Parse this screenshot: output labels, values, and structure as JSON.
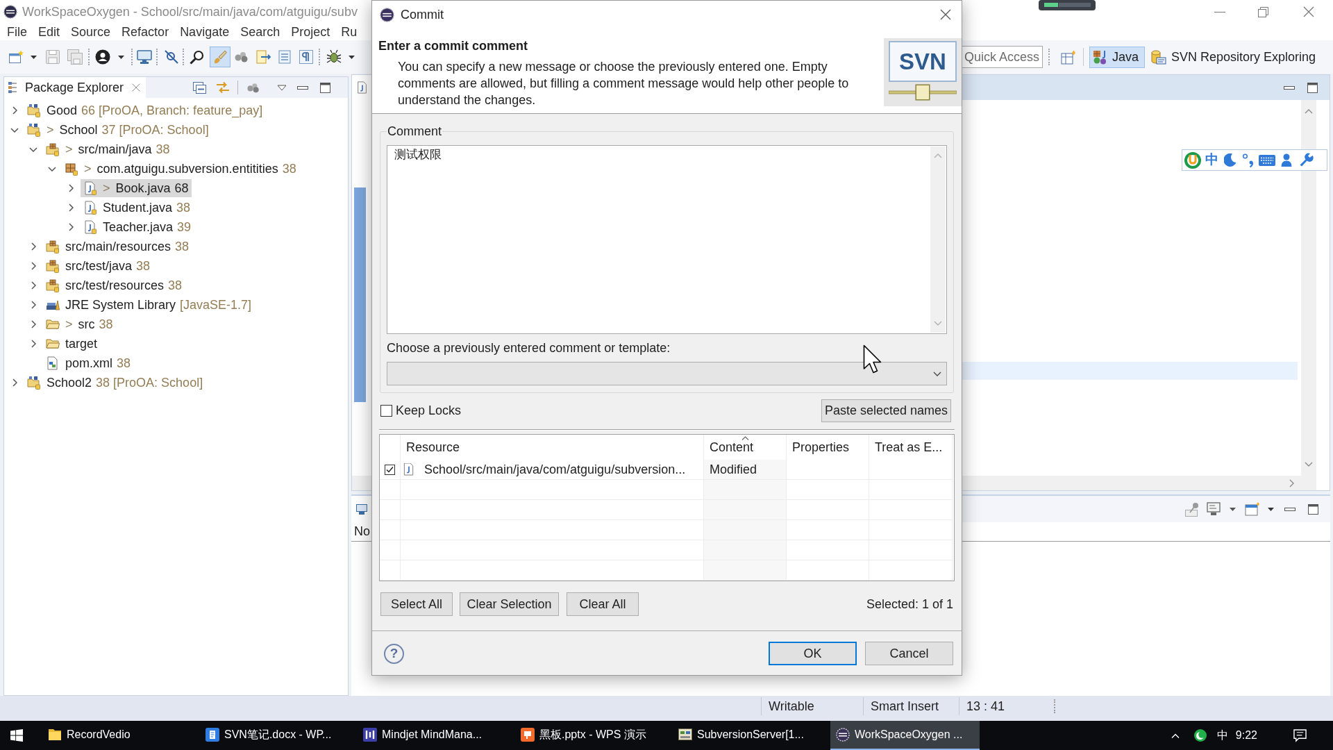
{
  "window": {
    "title": "WorkSpaceOxygen - School/src/main/java/com/atguigu/subv"
  },
  "menu": [
    "File",
    "Edit",
    "Source",
    "Refactor",
    "Navigate",
    "Search",
    "Project",
    "Ru"
  ],
  "toolbar": {
    "highlight_toggle": {
      "on": true
    }
  },
  "quick_access": {
    "placeholder": "Quick Access"
  },
  "perspectives": [
    {
      "kind": "java",
      "label": "Java",
      "selected": true
    },
    {
      "kind": "svn",
      "label": "SVN Repository Exploring",
      "selected": false
    }
  ],
  "package_explorer": {
    "title": "Package Explorer",
    "tree": [
      {
        "kind": "project",
        "label": "Good",
        "decoration": "66 [ProOA, Branch: feature_pay]",
        "expanded": false,
        "selected": false
      },
      {
        "kind": "project",
        "prefix": ">",
        "label": "School",
        "decoration": "37 [ProOA: School]",
        "expanded": true,
        "selected": false,
        "children": [
          {
            "kind": "source_folder",
            "prefix": ">",
            "label": "src/main/java",
            "decoration": "38",
            "expanded": true,
            "selected": false,
            "children": [
              {
                "kind": "package",
                "prefix": ">",
                "label": "com.atguigu.subversion.entitities",
                "decoration": "38",
                "expanded": true,
                "selected": false,
                "children": [
                  {
                    "kind": "java_file",
                    "prefix": ">",
                    "label": "Book.java",
                    "decoration": "68",
                    "expanded": false,
                    "selected": true
                  },
                  {
                    "kind": "java_file",
                    "label": "Student.java",
                    "decoration": "38",
                    "expanded": false,
                    "selected": false
                  },
                  {
                    "kind": "java_file",
                    "label": "Teacher.java",
                    "decoration": "39",
                    "expanded": false,
                    "selected": false
                  }
                ]
              }
            ]
          },
          {
            "kind": "source_folder",
            "label": "src/main/resources",
            "decoration": "38",
            "expanded": false,
            "selected": false
          },
          {
            "kind": "source_folder",
            "label": "src/test/java",
            "decoration": "38",
            "expanded": false,
            "selected": false
          },
          {
            "kind": "source_folder",
            "label": "src/test/resources",
            "decoration": "38",
            "expanded": false,
            "selected": false
          },
          {
            "kind": "library",
            "label": "JRE System Library",
            "decoration": "[JavaSE-1.7]",
            "expanded": false,
            "selected": false
          },
          {
            "kind": "folder",
            "prefix": ">",
            "label": "src",
            "decoration": "38",
            "expanded": false,
            "selected": false
          },
          {
            "kind": "folder",
            "label": "target",
            "expanded": false,
            "selected": false
          },
          {
            "kind": "xml_file",
            "label": "pom.xml",
            "decoration": "38",
            "selected": false
          }
        ]
      },
      {
        "kind": "project",
        "label": "School2",
        "decoration": "38 [ProOA: School]",
        "expanded": false,
        "selected": false
      }
    ]
  },
  "console": {
    "message": "No"
  },
  "ime_toolbar": {
    "mode": "中"
  },
  "dialog": {
    "title": "Commit",
    "heading": "Enter a commit comment",
    "description": "You can specify a new message or choose the previously entered one. Empty comments are allowed, but filling a comment message would help other people to understand the changes.",
    "logo_text": "SVN",
    "comment_label": "Comment",
    "comment": "测试权限",
    "template_label": "Choose a previously entered comment or template:",
    "keep_locks": {
      "label": "Keep Locks",
      "checked": false
    },
    "paste_button": "Paste selected names",
    "table": {
      "columns": [
        {
          "label": "Resource",
          "sorted": false
        },
        {
          "label": "Content",
          "sorted": true
        },
        {
          "label": "Properties",
          "sorted": false
        },
        {
          "label": "Treat as E...",
          "sorted": false
        }
      ],
      "rows": [
        {
          "checked": true,
          "resource": "School/src/main/java/com/atguigu/subversion...",
          "content": "Modified"
        }
      ]
    },
    "selection_buttons": [
      "Select All",
      "Clear Selection",
      "Clear All"
    ],
    "selection_count": "Selected: 1 of 1",
    "help": "?",
    "buttons": [
      {
        "label": "OK",
        "default": true
      },
      {
        "label": "Cancel",
        "default": false
      }
    ]
  },
  "status_bar": [
    "Writable",
    "Smart Insert",
    "13 : 41"
  ],
  "taskbar": {
    "apps": [
      {
        "kind": "folder",
        "label": "RecordVedio",
        "selected": false
      },
      {
        "kind": "writer",
        "label": "SVN笔记.docx - WP...",
        "selected": false
      },
      {
        "kind": "mindmap",
        "label": "Mindjet MindMana...",
        "selected": false
      },
      {
        "kind": "slides",
        "label": "黑板.pptx - WPS 演示",
        "selected": false
      },
      {
        "kind": "server",
        "label": "SubversionServer[1...",
        "selected": false
      },
      {
        "kind": "ide",
        "label": "WorkSpaceOxygen ...",
        "selected": true
      }
    ],
    "tray": {
      "input_language": "中",
      "time": "9:22"
    }
  }
}
